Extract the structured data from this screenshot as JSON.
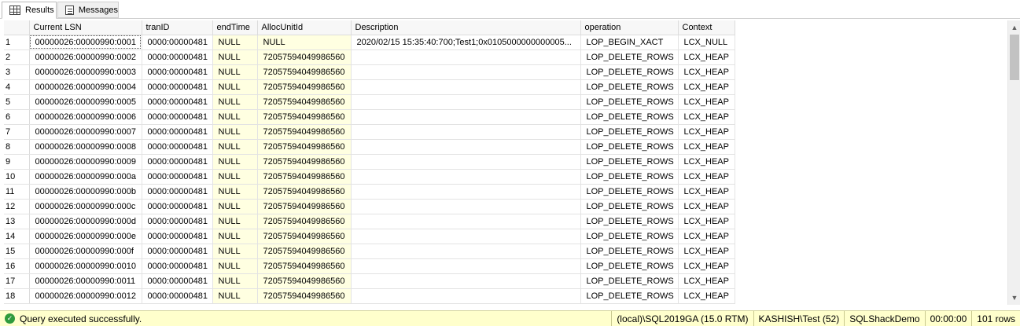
{
  "tabs": [
    {
      "label": "Results",
      "icon": "grid-icon",
      "active": true
    },
    {
      "label": "Messages",
      "icon": "messages-icon",
      "active": false
    }
  ],
  "grid": {
    "columns": [
      "Current LSN",
      "tranID",
      "endTime",
      "AllocUnitId",
      "Description",
      "operation",
      "Context"
    ],
    "rows": [
      {
        "n": "1",
        "lsn": "00000026:00000990:0001",
        "tran": "0000:00000481",
        "end": "NULL",
        "alloc": "NULL",
        "desc": "2020/02/15 15:35:40:700;Test1;0x0105000000000005...",
        "op": "LOP_BEGIN_XACT",
        "ctx": "LCX_NULL"
      },
      {
        "n": "2",
        "lsn": "00000026:00000990:0002",
        "tran": "0000:00000481",
        "end": "NULL",
        "alloc": "72057594049986560",
        "desc": "",
        "op": "LOP_DELETE_ROWS",
        "ctx": "LCX_HEAP"
      },
      {
        "n": "3",
        "lsn": "00000026:00000990:0003",
        "tran": "0000:00000481",
        "end": "NULL",
        "alloc": "72057594049986560",
        "desc": "",
        "op": "LOP_DELETE_ROWS",
        "ctx": "LCX_HEAP"
      },
      {
        "n": "4",
        "lsn": "00000026:00000990:0004",
        "tran": "0000:00000481",
        "end": "NULL",
        "alloc": "72057594049986560",
        "desc": "",
        "op": "LOP_DELETE_ROWS",
        "ctx": "LCX_HEAP"
      },
      {
        "n": "5",
        "lsn": "00000026:00000990:0005",
        "tran": "0000:00000481",
        "end": "NULL",
        "alloc": "72057594049986560",
        "desc": "",
        "op": "LOP_DELETE_ROWS",
        "ctx": "LCX_HEAP"
      },
      {
        "n": "6",
        "lsn": "00000026:00000990:0006",
        "tran": "0000:00000481",
        "end": "NULL",
        "alloc": "72057594049986560",
        "desc": "",
        "op": "LOP_DELETE_ROWS",
        "ctx": "LCX_HEAP"
      },
      {
        "n": "7",
        "lsn": "00000026:00000990:0007",
        "tran": "0000:00000481",
        "end": "NULL",
        "alloc": "72057594049986560",
        "desc": "",
        "op": "LOP_DELETE_ROWS",
        "ctx": "LCX_HEAP"
      },
      {
        "n": "8",
        "lsn": "00000026:00000990:0008",
        "tran": "0000:00000481",
        "end": "NULL",
        "alloc": "72057594049986560",
        "desc": "",
        "op": "LOP_DELETE_ROWS",
        "ctx": "LCX_HEAP"
      },
      {
        "n": "9",
        "lsn": "00000026:00000990:0009",
        "tran": "0000:00000481",
        "end": "NULL",
        "alloc": "72057594049986560",
        "desc": "",
        "op": "LOP_DELETE_ROWS",
        "ctx": "LCX_HEAP"
      },
      {
        "n": "10",
        "lsn": "00000026:00000990:000a",
        "tran": "0000:00000481",
        "end": "NULL",
        "alloc": "72057594049986560",
        "desc": "",
        "op": "LOP_DELETE_ROWS",
        "ctx": "LCX_HEAP"
      },
      {
        "n": "11",
        "lsn": "00000026:00000990:000b",
        "tran": "0000:00000481",
        "end": "NULL",
        "alloc": "72057594049986560",
        "desc": "",
        "op": "LOP_DELETE_ROWS",
        "ctx": "LCX_HEAP"
      },
      {
        "n": "12",
        "lsn": "00000026:00000990:000c",
        "tran": "0000:00000481",
        "end": "NULL",
        "alloc": "72057594049986560",
        "desc": "",
        "op": "LOP_DELETE_ROWS",
        "ctx": "LCX_HEAP"
      },
      {
        "n": "13",
        "lsn": "00000026:00000990:000d",
        "tran": "0000:00000481",
        "end": "NULL",
        "alloc": "72057594049986560",
        "desc": "",
        "op": "LOP_DELETE_ROWS",
        "ctx": "LCX_HEAP"
      },
      {
        "n": "14",
        "lsn": "00000026:00000990:000e",
        "tran": "0000:00000481",
        "end": "NULL",
        "alloc": "72057594049986560",
        "desc": "",
        "op": "LOP_DELETE_ROWS",
        "ctx": "LCX_HEAP"
      },
      {
        "n": "15",
        "lsn": "00000026:00000990:000f",
        "tran": "0000:00000481",
        "end": "NULL",
        "alloc": "72057594049986560",
        "desc": "",
        "op": "LOP_DELETE_ROWS",
        "ctx": "LCX_HEAP"
      },
      {
        "n": "16",
        "lsn": "00000026:00000990:0010",
        "tran": "0000:00000481",
        "end": "NULL",
        "alloc": "72057594049986560",
        "desc": "",
        "op": "LOP_DELETE_ROWS",
        "ctx": "LCX_HEAP"
      },
      {
        "n": "17",
        "lsn": "00000026:00000990:0011",
        "tran": "0000:00000481",
        "end": "NULL",
        "alloc": "72057594049986560",
        "desc": "",
        "op": "LOP_DELETE_ROWS",
        "ctx": "LCX_HEAP"
      },
      {
        "n": "18",
        "lsn": "00000026:00000990:0012",
        "tran": "0000:00000481",
        "end": "NULL",
        "alloc": "72057594049986560",
        "desc": "",
        "op": "LOP_DELETE_ROWS",
        "ctx": "LCX_HEAP"
      }
    ]
  },
  "status": {
    "message": "Query executed successfully.",
    "server": "(local)\\SQL2019GA (15.0 RTM)",
    "user": "KASHISH\\Test (52)",
    "database": "SQLShackDemo",
    "elapsed": "00:00:00",
    "rows": "101 rows",
    "ok_icon": "check-circle-icon",
    "bar_color": "#ffffcc"
  }
}
